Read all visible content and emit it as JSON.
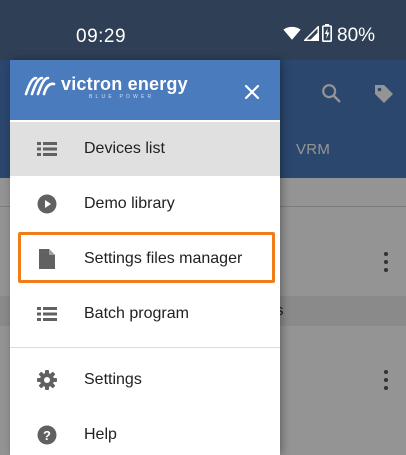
{
  "status_bar": {
    "time": "09:29",
    "battery": "80%",
    "icons": [
      "wifi-icon",
      "signal-icon",
      "battery-icon"
    ]
  },
  "background_app": {
    "actions": [
      "search-icon",
      "tag-icon"
    ],
    "tab_label": "VRM",
    "section_label_fragment": "s"
  },
  "drawer": {
    "brand": {
      "name": "victron energy",
      "tagline": "BLUE POWER"
    },
    "items": [
      {
        "label": "Devices list",
        "icon": "list-icon",
        "active": true
      },
      {
        "label": "Demo library",
        "icon": "play-circle-icon",
        "active": false
      },
      {
        "label": "Settings files manager",
        "icon": "file-icon",
        "active": false,
        "highlighted": true
      },
      {
        "label": "Batch program",
        "icon": "list-icon",
        "active": false
      }
    ],
    "secondary_items": [
      {
        "label": "Settings",
        "icon": "gear-icon"
      },
      {
        "label": "Help",
        "icon": "help-circle-icon"
      }
    ]
  },
  "colors": {
    "status_bar": "#2f3f55",
    "brand_blue": "#4a7bbd",
    "highlight": "#f07d1a",
    "icon_gray": "#616161",
    "active_item_bg": "#e0e0e0"
  }
}
